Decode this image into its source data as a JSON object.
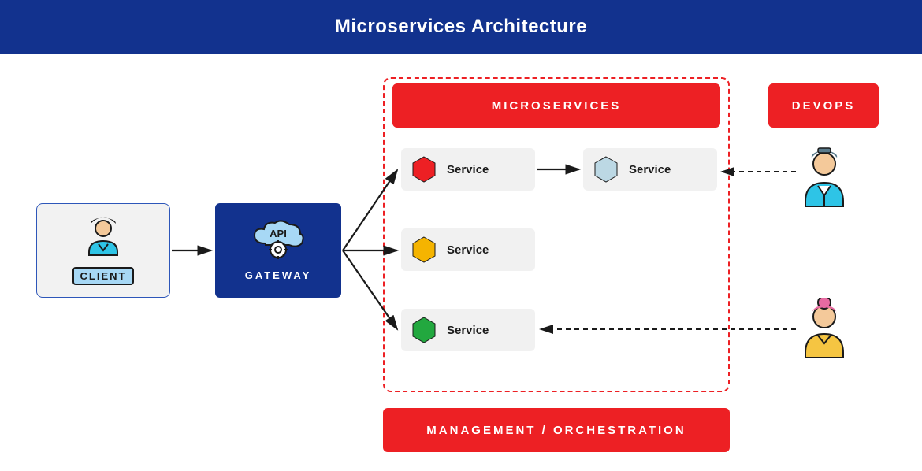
{
  "title": "Microservices Architecture",
  "client": {
    "label": "CLIENT"
  },
  "gateway": {
    "label": "GATEWAY",
    "cloud_label": "API"
  },
  "microservices": {
    "header": "MICROSERVICES",
    "services": [
      {
        "label": "Service",
        "color": "#ed2024"
      },
      {
        "label": "Service",
        "color": "#bcd8e4"
      },
      {
        "label": "Service",
        "color": "#f5b400"
      },
      {
        "label": "Service",
        "color": "#22a83f"
      }
    ]
  },
  "management": {
    "label": "MANAGEMENT / ORCHESTRATION"
  },
  "devops": {
    "label": "DEVOPS"
  }
}
